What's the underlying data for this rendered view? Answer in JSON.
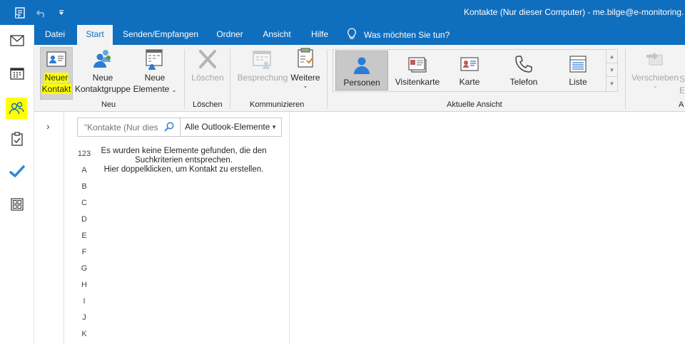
{
  "window": {
    "title": "Kontakte (Nur dieser Computer) - me.bilge@e-monitoring."
  },
  "tabs": [
    "Datei",
    "Start",
    "Senden/Empfangen",
    "Ordner",
    "Ansicht",
    "Hilfe"
  ],
  "tell_me": "Was möchten Sie tun?",
  "ribbon": {
    "neu": {
      "new_contact_line1": "Neuer",
      "new_contact_line2": "Kontakt",
      "new_group_line1": "Neue",
      "new_group_line2": "Kontaktgruppe",
      "new_items_line1": "Neue",
      "new_items_line2": "Elemente",
      "group_label": "Neu"
    },
    "loeschen": {
      "delete_label": "Löschen",
      "group_label": "Löschen"
    },
    "kommunizieren": {
      "meeting_label": "Besprechung",
      "more_label": "Weitere",
      "group_label": "Kommunizieren"
    },
    "aktuelle_ansicht": {
      "views": [
        "Personen",
        "Visitenkarte",
        "Karte",
        "Telefon",
        "Liste"
      ],
      "selected": "Personen",
      "group_label": "Aktuelle Ansicht"
    },
    "aktionen": {
      "move_label": "Verschieben",
      "partial_s": "S",
      "partial_e": "E",
      "group_label_partial": "A"
    }
  },
  "search": {
    "placeholder": "\"Kontakte (Nur dies",
    "scope": "Alle Outlook-Elemente"
  },
  "index_letters": [
    "123",
    "A",
    "B",
    "C",
    "D",
    "E",
    "F",
    "G",
    "H",
    "I",
    "J",
    "K"
  ],
  "empty_message": {
    "line1": "Es wurden keine Elemente gefunden, die den",
    "line2": "Suchkriterien entsprechen.",
    "line3": "Hier doppelklicken, um Kontakt zu erstellen."
  },
  "colors": {
    "accent": "#106ebe",
    "highlight": "#ffff00",
    "ribbon_bg": "#f3f3f3"
  }
}
